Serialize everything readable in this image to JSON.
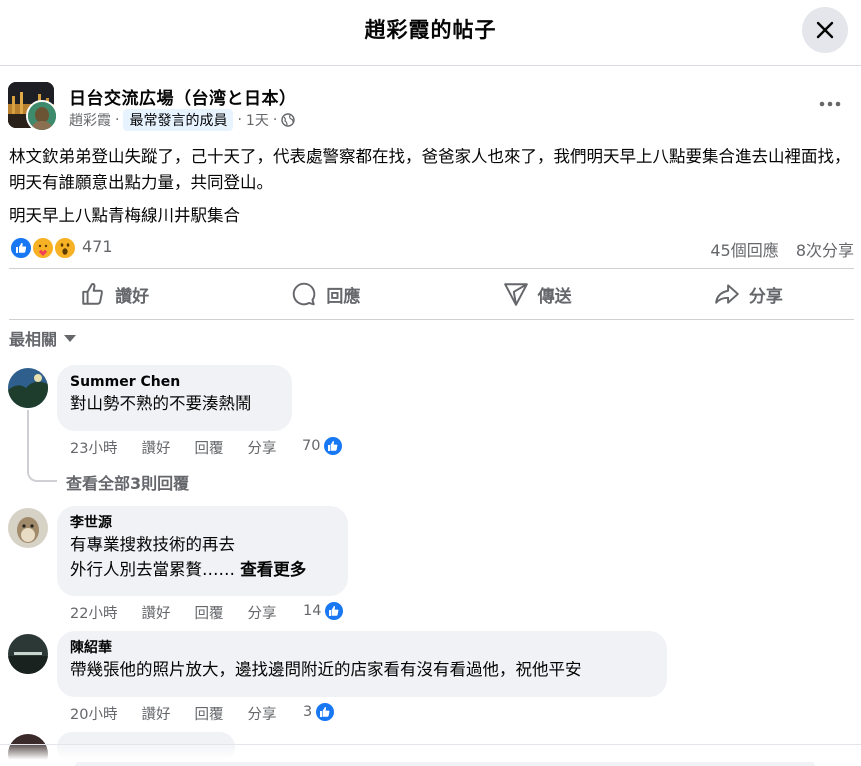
{
  "header": {
    "title": "趙彩霞的帖子"
  },
  "post": {
    "group_name": "日台交流広場（台湾と日本）",
    "author": "趙彩霞",
    "badge": "最常發言的成員",
    "time": "1天",
    "body_1": "林文欽弟弟登山失蹤了，己十天了，代表處警察都在找，爸爸家人也來了，我們明天早上八點要集合進去山裡面找，明天有誰願意出點力量，共同登山。",
    "body_2": "明天早上八點青梅線川井駅集合",
    "reaction_count": "471",
    "comments_count": "45個回應",
    "shares_count": "8次分享"
  },
  "actions": {
    "like": "讚好",
    "comment": "回應",
    "send": "傳送",
    "share": "分享"
  },
  "sort_label": "最相關",
  "comments": [
    {
      "name": "Summer Chen",
      "text": "對山勢不熟的不要湊熱鬧",
      "time": "23小時",
      "like": "讚好",
      "reply": "回覆",
      "share": "分享",
      "likes": "70",
      "view_replies": "查看全部3則回覆"
    },
    {
      "name": "李世源",
      "text_1": "有專業搜救技術的再去",
      "text_2": "外行人別去當累贅……",
      "see_more": "查看更多",
      "time": "22小時",
      "like": "讚好",
      "reply": "回覆",
      "share": "分享",
      "likes": "14"
    },
    {
      "name": "陳紹華",
      "text": "帶幾張他的照片放大，邊找邊問附近的店家看有沒有看過他，祝他平安",
      "time": "20小時",
      "like": "讚好",
      "reply": "回覆",
      "share": "分享",
      "likes": "3"
    }
  ],
  "colors": {
    "accent": "#1877f2",
    "secondary_text": "#65676b",
    "bubble": "#f0f2f5"
  }
}
